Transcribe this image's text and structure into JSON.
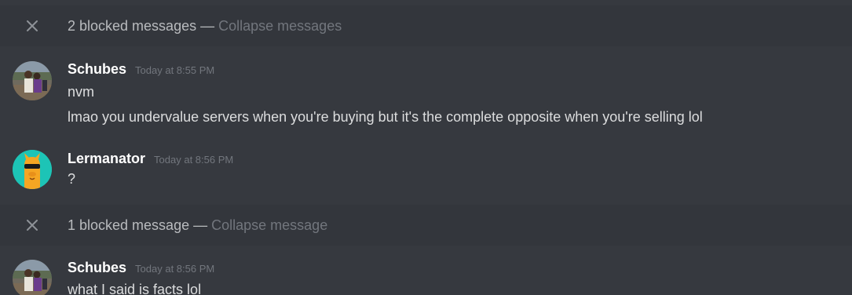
{
  "colors": {
    "background": "#36393f",
    "blocked_bar": "#33363c",
    "username": "#ffffff",
    "message_text": "#dcddde",
    "muted": "#72767d",
    "lermanator_avatar_bg": "#1dc4b6"
  },
  "blocked_groups": [
    {
      "icon": "close-icon",
      "label": "2 blocked messages",
      "separator": "—",
      "action": "Collapse messages"
    },
    {
      "icon": "close-icon",
      "label": "1 blocked message",
      "separator": "—",
      "action": "Collapse message"
    }
  ],
  "messages": [
    {
      "author": "Schubes",
      "avatar": "photo-avatar",
      "timestamp": "Today at 8:55 PM",
      "lines": [
        "nvm",
        "lmao you undervalue servers when you're buying but it's the complete opposite when you're selling lol"
      ]
    },
    {
      "author": "Lermanator",
      "avatar": "llama-sunglasses-avatar",
      "timestamp": "Today at 8:56 PM",
      "lines": [
        "?"
      ]
    },
    {
      "author": "Schubes",
      "avatar": "photo-avatar",
      "timestamp": "Today at 8:56 PM",
      "lines": [
        "what I said is facts lol"
      ]
    }
  ]
}
